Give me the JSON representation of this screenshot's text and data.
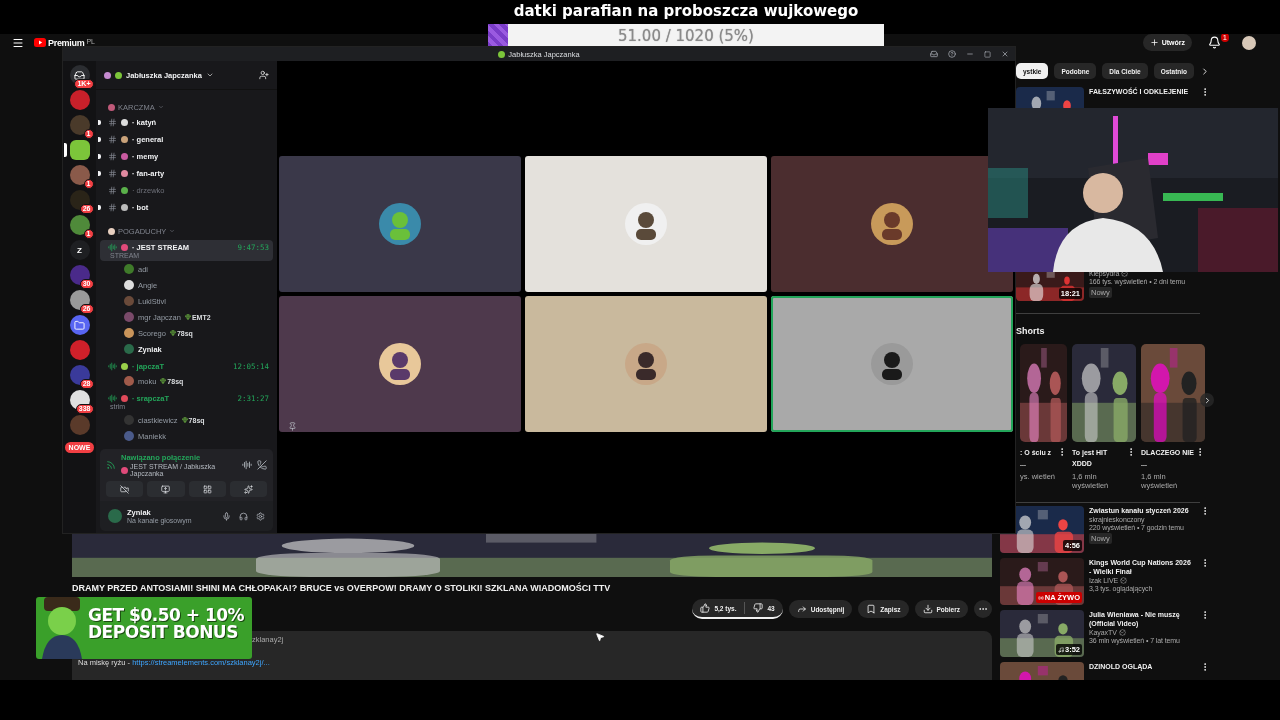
{
  "donation": {
    "title": "datki parafian na proboszcza wujkowego",
    "level": 0.05,
    "reading": "51.00 / 1020 (5%)"
  },
  "youtube": {
    "header": {
      "logo": "Premium",
      "region": "PL",
      "create_label": "Utwórz",
      "notifications": "1"
    },
    "video": {
      "title": "DRAMY PRZED ANTOSIAMI! SHINI MA CHŁOPAKA!? BRUCE vs OVERPOW! DRAMY O STOLIKI! SZKLANA WIADOMOŚCI TTV",
      "likes": "5,2 tys.",
      "dislikes": "43",
      "actions": [
        {
          "kind": "share",
          "label": "Udostępnij"
        },
        {
          "kind": "save",
          "label": "Zapisz"
        },
        {
          "kind": "download",
          "label": "Pobierz"
        }
      ]
    },
    "description": {
      "handle": "zklanay2j",
      "label": "Na miskę ryżu - ",
      "link": "https://streamelements.com/szklanay2j/..."
    },
    "chips": [
      {
        "label": "ystkie",
        "selected": true
      },
      {
        "label": "Podobne",
        "selected": false
      },
      {
        "label": "Dla Ciebie",
        "selected": false
      },
      {
        "label": "Ostatnio",
        "selected": false
      }
    ],
    "top_item": {
      "title": "FAŁSZYWOŚĆ I ODKLEJENIE"
    },
    "second_item": {
      "channel": "Klepsydra",
      "verified": true,
      "stats": "166 tys. wyświetleń • 2 dni temu",
      "badge": "Nowy",
      "duration": "18:21"
    },
    "shorts_heading": "Shorts",
    "shorts": [
      {
        "title": ": O ściu z ...",
        "views": "ys. wietleń"
      },
      {
        "title": "To jest HIT XDDD",
        "views": "1,6 mln wyświetleń"
      },
      {
        "title": "DLACZEGO NIE ...",
        "views": "1,6 mln wyświetleń"
      }
    ],
    "recommended": [
      {
        "title": "Zwiastun kanału styczeń 2026",
        "channel": "skrajnieskonczony",
        "verified": false,
        "stats": "220 wyświetleń • 7 godzin temu",
        "badge": "Nowy",
        "overlay": {
          "kind": "duration",
          "text": "4:56"
        }
      },
      {
        "title": "Kings World Cup Nations 2026 - Wielki Finał",
        "channel": "Izak LIVE",
        "verified": true,
        "stats": "3,3 tys. oglądających",
        "overlay": {
          "kind": "live",
          "text": "NA ŻYWO"
        }
      },
      {
        "title": "Julia Wieniawa - Nie muszę (Official Video)",
        "channel": "KayaxTV",
        "verified": true,
        "stats": "36 mln wyświetleń • 7 lat temu",
        "overlay": {
          "kind": "music",
          "text": "3:52"
        }
      },
      {
        "title": "DZINOLD OGLĄDA"
      }
    ]
  },
  "ad": {
    "lines": [
      "GET $0.50 + 10%",
      "DEPOSIT BONUS"
    ]
  },
  "discord": {
    "window_title": "Jabłuszka Japczanka",
    "servers": [
      {
        "kind": "home",
        "badge": "1K+",
        "selected": false,
        "color": "#2b2d31"
      },
      {
        "kind": "avatar",
        "selected": false,
        "color": "#c8202a"
      },
      {
        "kind": "avatar",
        "badge": "1",
        "selected": false,
        "color": "#4a3a2a"
      },
      {
        "kind": "avatar",
        "selected": true,
        "color": "#7cc53a"
      },
      {
        "kind": "avatar",
        "badge": "1",
        "selected": false,
        "color": "#8a5a4a"
      },
      {
        "kind": "avatar",
        "badge": "26",
        "selected": false,
        "color": "#2a2418"
      },
      {
        "kind": "avatar",
        "badge": "1",
        "selected": false,
        "color": "#4f8a3a"
      },
      {
        "kind": "initial",
        "label": "Z",
        "selected": false,
        "color": "#1e1f22"
      },
      {
        "kind": "avatar",
        "badge": "30",
        "selected": false,
        "color": "#4a2a8a"
      },
      {
        "kind": "avatar",
        "badge": "26",
        "selected": false,
        "color": "#9a9a9a"
      },
      {
        "kind": "folder",
        "selected": false,
        "color": "#5865f2"
      },
      {
        "kind": "avatar",
        "selected": false,
        "color": "#d0202a"
      },
      {
        "kind": "avatar",
        "badge": "28",
        "selected": false,
        "color": "#3a3a9a"
      },
      {
        "kind": "avatar",
        "badge": "338",
        "selected": false,
        "color": "#e0e0e0"
      },
      {
        "kind": "avatar",
        "selected": false,
        "color": "#5a3a2a"
      }
    ],
    "new_pill": "NOWE",
    "server_name": "Jabłuszka Japczanka",
    "text_category": {
      "name": "KARCZMA",
      "channels": [
        {
          "name": "· katyń",
          "unread": true
        },
        {
          "name": "· general",
          "unread": true
        },
        {
          "name": "· memy",
          "unread": true
        },
        {
          "name": "· fan-arty",
          "unread": true
        },
        {
          "name": "· drzewko",
          "unread": false
        },
        {
          "name": "· bot",
          "unread": true
        }
      ]
    },
    "voice_category": {
      "name": "POGADUCHY",
      "channels": [
        {
          "name": "· JEST STREAM",
          "timer": "9:47:53",
          "status": "STREAM",
          "selected": true,
          "members": [
            {
              "name": "adi",
              "self": false
            },
            {
              "name": "Angie",
              "self": false
            },
            {
              "name": "LuklStivl",
              "self": false
            },
            {
              "name": "mgr Japczan",
              "tag": "EMT2",
              "self": false
            },
            {
              "name": "Scorego",
              "tag": "78sq",
              "self": false
            },
            {
              "name": "Zyniak",
              "self": true
            }
          ]
        },
        {
          "name": "· japczaT",
          "timer": "12:05:14",
          "selected": false,
          "members": [
            {
              "name": "moku",
              "tag": "78sq",
              "self": false
            }
          ]
        },
        {
          "name": "· srapczaT",
          "timer": "2:31:27",
          "status": "strim",
          "selected": false,
          "members": [
            {
              "name": "ciastkiewicz",
              "tag": "78sq",
              "self": false
            },
            {
              "name": "Maniekk",
              "self": false
            }
          ]
        }
      ]
    },
    "voice_status": {
      "title": "Nawiązano połączenie",
      "channel": "JEST STREAM / Jabłuszka Japczanka"
    },
    "user": {
      "name": "Zyniak",
      "status": "Na kanale głosowym"
    },
    "tiles": [
      {
        "color": "#3a3849",
        "selected": false
      },
      {
        "color": "#e4e1dc",
        "selected": false
      },
      {
        "color": "#4b2d2f",
        "selected": false
      },
      {
        "color": "#4e394c",
        "selected": false
      },
      {
        "color": "#c9b99d",
        "selected": false
      },
      {
        "color": "#a9a9a9",
        "selected": true
      }
    ]
  }
}
